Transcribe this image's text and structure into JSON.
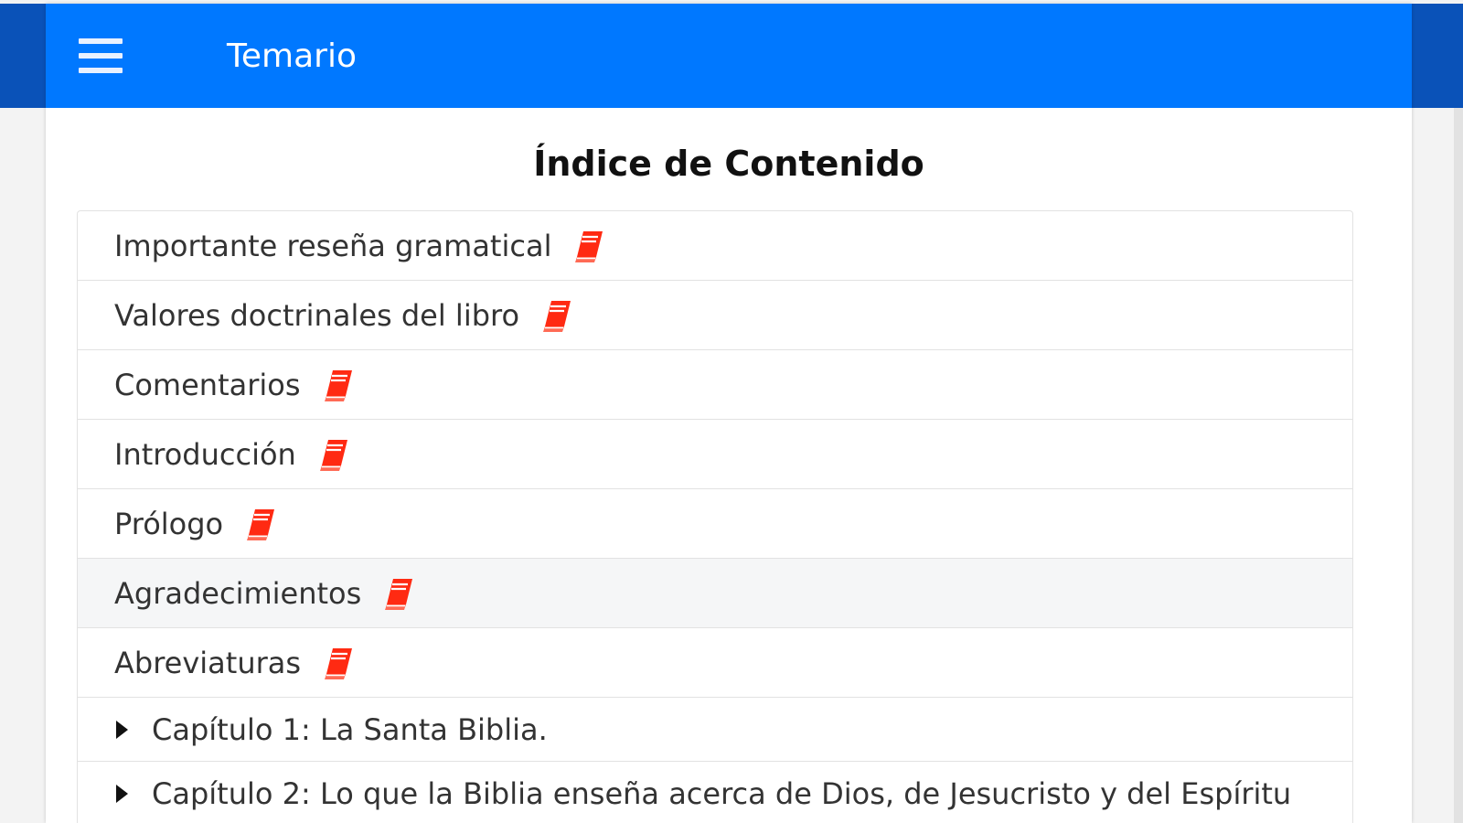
{
  "toolbar": {
    "title": "Temario",
    "menu_icon": "hamburger-menu-icon",
    "background": "#0078ff"
  },
  "content": {
    "title": "Índice de Contenido"
  },
  "toc": {
    "book_icon": "red-book-icon",
    "book_icon_color": "#ff2a12",
    "items": [
      {
        "label": "Importante reseña gramatical"
      },
      {
        "label": "Valores doctrinales del libro"
      },
      {
        "label": "Comentarios"
      },
      {
        "label": "Introducción"
      },
      {
        "label": "Prólogo"
      },
      {
        "label": "Agradecimientos"
      },
      {
        "label": "Abreviaturas"
      }
    ],
    "chapters": [
      {
        "label": "Capítulo 1: La Santa Biblia."
      },
      {
        "label": "Capítulo 2: Lo que la Biblia enseña acerca de Dios, de Jesucristo y del Espíritu"
      }
    ]
  }
}
